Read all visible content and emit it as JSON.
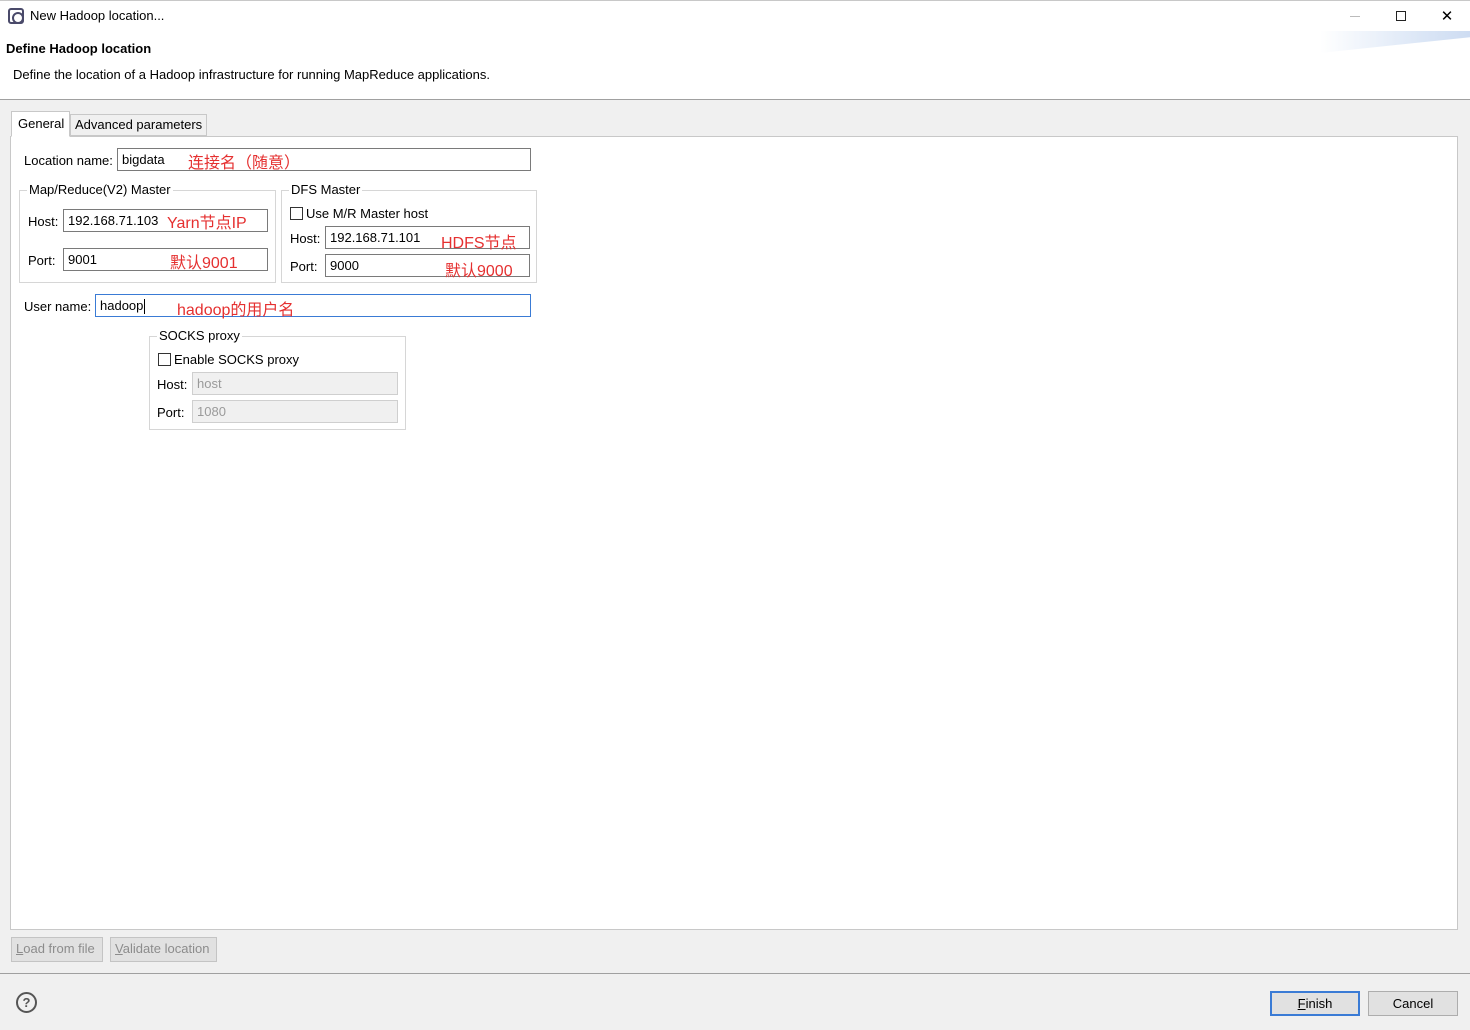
{
  "window": {
    "title": "New Hadoop location...",
    "minimize_glyph": "",
    "maximize_glyph": "",
    "close_glyph": "✕"
  },
  "header": {
    "title": "Define Hadoop location",
    "description": "Define the location of a Hadoop infrastructure for running MapReduce applications."
  },
  "tabs": [
    {
      "label": "General",
      "selected": true
    },
    {
      "label": "Advanced parameters",
      "selected": false
    }
  ],
  "general": {
    "location_name_label": "Location name:",
    "location_name_value": "bigdata",
    "location_name_note": "连接名（随意）",
    "mr_master": {
      "title": "Map/Reduce(V2) Master",
      "host_label": "Host:",
      "host_value": "192.168.71.103",
      "host_note": "Yarn节点IP",
      "port_label": "Port:",
      "port_value": "9001",
      "port_note": "默认9001"
    },
    "dfs_master": {
      "title": "DFS Master",
      "use_mr_label": "Use M/R Master host",
      "use_mr_checked": false,
      "host_label": "Host:",
      "host_value": "192.168.71.101",
      "host_note": "HDFS节点",
      "port_label": "Port:",
      "port_value": "9000",
      "port_note": "默认9000"
    },
    "user_name_label": "User name:",
    "user_name_value": "hadoop",
    "user_name_note": "hadoop的用户名",
    "socks": {
      "title": "SOCKS proxy",
      "enable_label": "Enable SOCKS proxy",
      "enable_checked": false,
      "host_label": "Host:",
      "host_value": "host",
      "port_label": "Port:",
      "port_value": "1080"
    }
  },
  "bottom_buttons": {
    "load_prefix": "L",
    "load_rest": "oad from file",
    "validate_prefix": "V",
    "validate_rest": "alidate location"
  },
  "footer": {
    "help_glyph": "?",
    "finish_prefix": "F",
    "finish_rest": "inish",
    "cancel_label": "Cancel"
  },
  "colors": {
    "annotation": "#e53030",
    "focus_border": "#3a7bd5"
  }
}
